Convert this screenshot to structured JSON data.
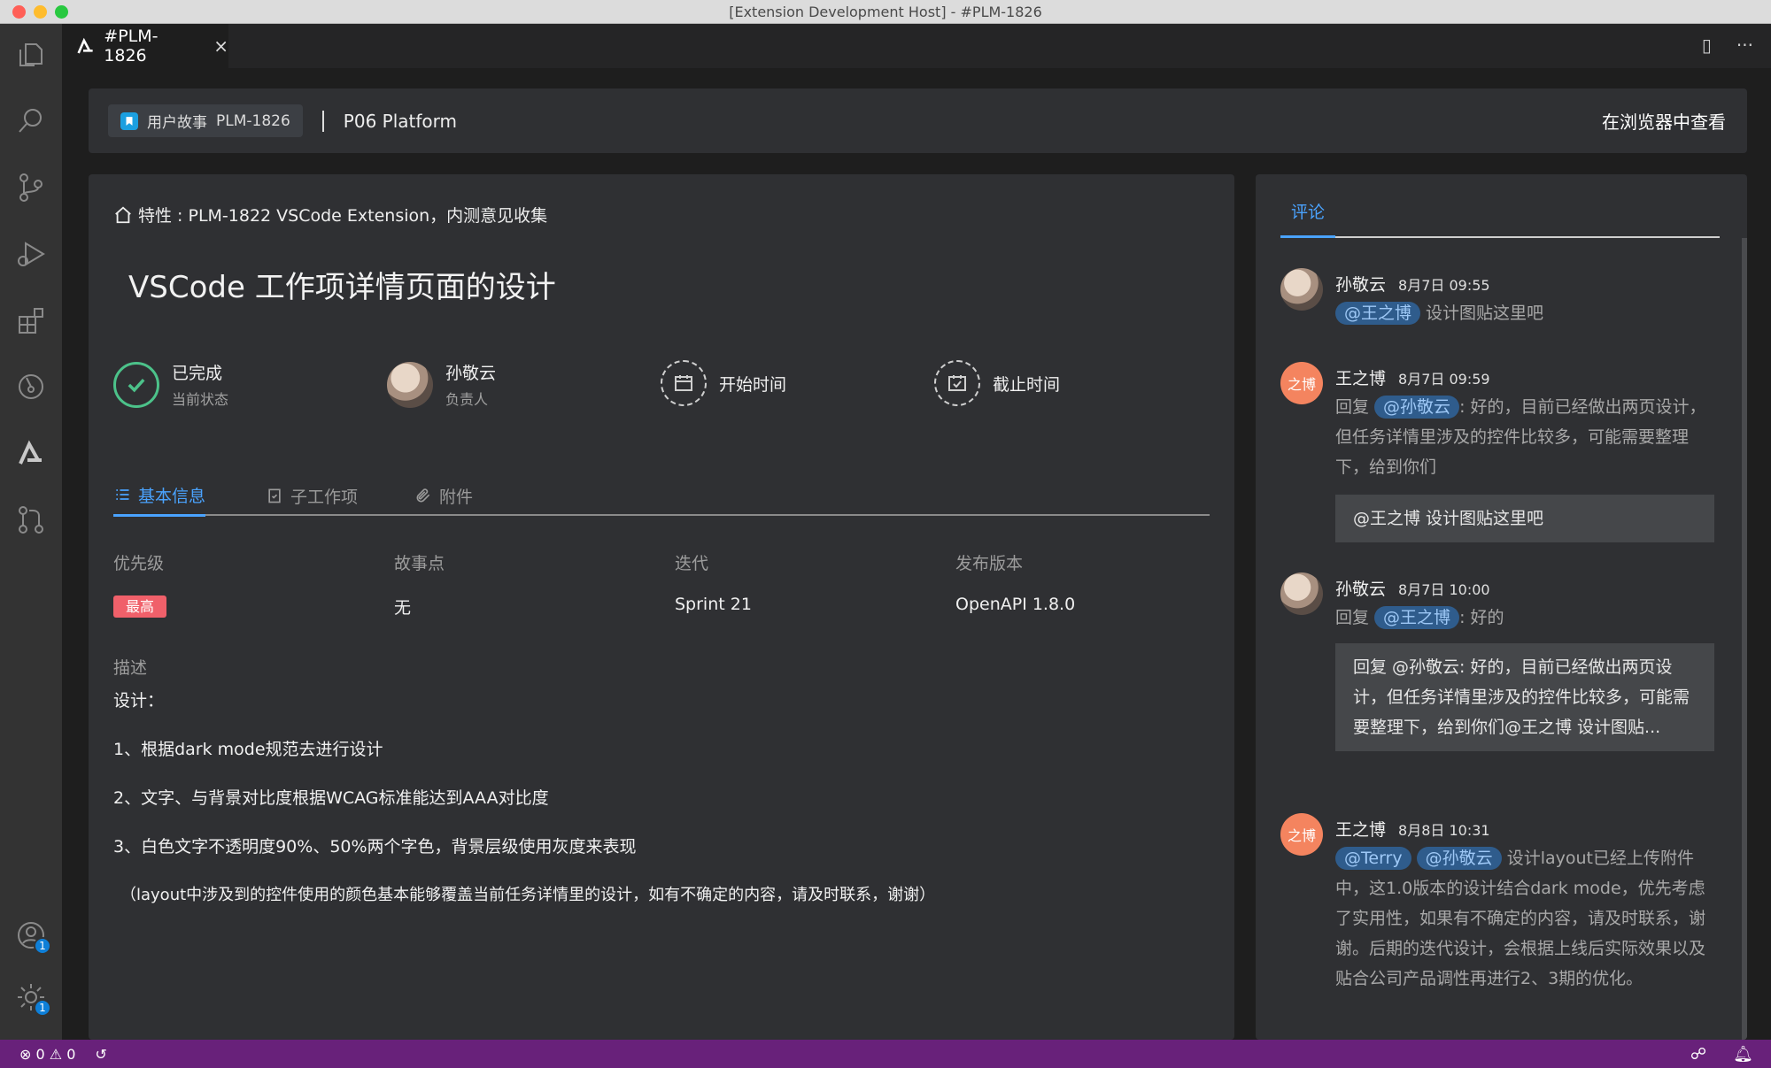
{
  "window": {
    "title": "[Extension Development Host] - #PLM-1826"
  },
  "editor_tab": {
    "label": "#PLM-1826",
    "close": "×"
  },
  "header": {
    "type_label": "用户故事",
    "item_id": "PLM-1826",
    "project": "P06 Platform",
    "open_in_browser": "在浏览器中查看"
  },
  "detail": {
    "breadcrumb": "特性 : PLM-1822  VSCode Extension，内测意见收集",
    "title": "VSCode 工作项详情页面的设计",
    "status": {
      "value": "已完成",
      "label": "当前状态"
    },
    "assignee": {
      "value": "孙敬云",
      "label": "负责人"
    },
    "start_time": "开始时间",
    "due_time": "截止时间",
    "tabs": [
      "基本信息",
      "子工作项",
      "附件"
    ],
    "fields": {
      "priority": {
        "label": "优先级",
        "value": "最高"
      },
      "story_points": {
        "label": "故事点",
        "value": "无"
      },
      "iteration": {
        "label": "迭代",
        "value": "Sprint 21"
      },
      "release": {
        "label": "发布版本",
        "value": "OpenAPI 1.8.0"
      }
    },
    "description_label": "描述",
    "description": [
      "设计：",
      "1、根据dark mode规范去进行设计",
      "2、文字、与背景对比度根据WCAG标准能达到AAA对比度",
      "3、白色文字不透明度90%、50%两个字色，背景层级使用灰度来表现",
      "（layout中涉及到的控件使用的颜色基本能够覆盖当前任务详情里的设计，如有不确定的内容，请及时联系，谢谢）"
    ]
  },
  "comments": {
    "tab": "评论",
    "items": [
      {
        "name": "孙敬云",
        "time": "8月7日 09:55",
        "mention": "@王之博",
        "text": " 设计图贴这里吧"
      },
      {
        "name": "王之博",
        "initials": "之博",
        "time": "8月7日 09:59",
        "prefix": "回复 ",
        "mention": "@孙敬云",
        "text": ": 好的，目前已经做出两页设计，但任务详情里涉及的控件比较多，可能需要整理下，给到你们",
        "quote": "@王之博 设计图贴这里吧"
      },
      {
        "name": "孙敬云",
        "time": "8月7日 10:00",
        "prefix": "回复 ",
        "mention": "@王之博",
        "text": ": 好的",
        "quote": "回复 @孙敬云: 好的，目前已经做出两页设计，但任务详情里涉及的控件比较多，可能需要整理下，给到你们@王之博 设计图贴..."
      },
      {
        "name": "王之博",
        "initials": "之博",
        "time": "8月8日 10:31",
        "mention": "@Terry",
        "mention2": "@孙敬云",
        "text": " 设计layout已经上传附件中，这1.0版本的设计结合dark mode，优先考虑了实用性，如果有不确定的内容，请及时联系，谢谢。后期的迭代设计，会根据上线后实际效果以及贴合公司产品调性再进行2、3期的优化。"
      }
    ]
  },
  "activity": {
    "accounts_badge": "1",
    "settings_badge": "1"
  },
  "status": {
    "errors": "0",
    "warnings": "0"
  },
  "colors": {
    "accent": "#4aa3ff",
    "status_bar": "#68217a",
    "priority": "#f0606a",
    "done": "#4cc28a"
  }
}
